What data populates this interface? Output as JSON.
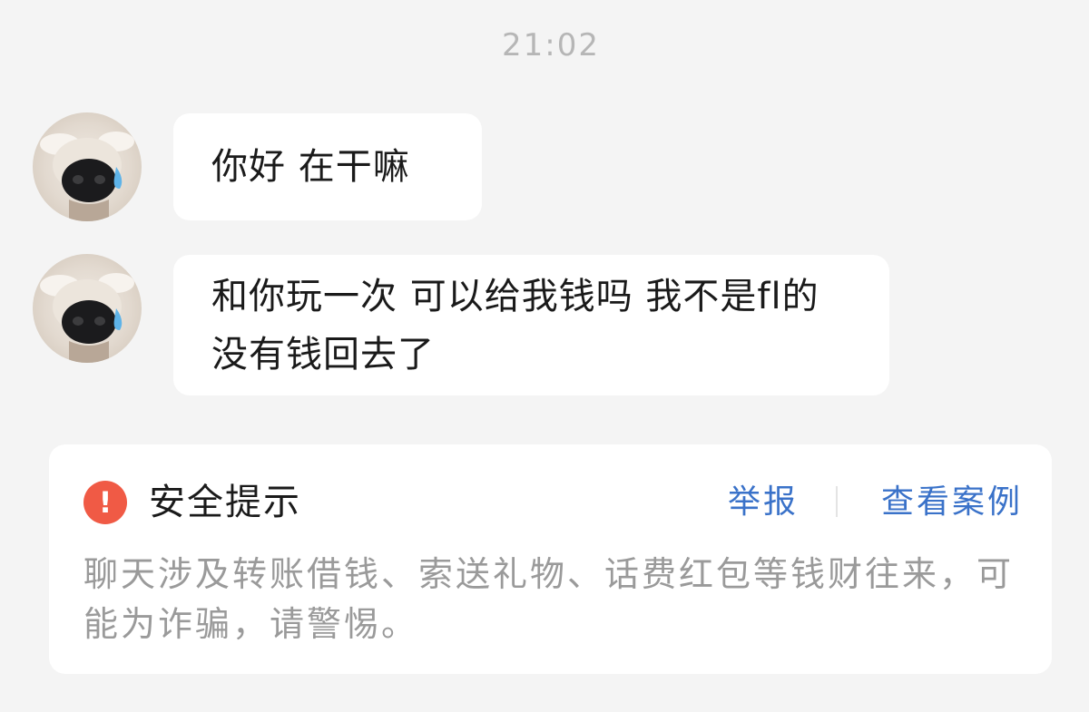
{
  "time": "21:02",
  "messages": [
    {
      "sender": "dog-avatar",
      "text": "你好 在干嘛"
    },
    {
      "sender": "dog-avatar",
      "text": "和你玩一次 可以给我钱吗 我不是fl的 没有钱回去了"
    }
  ],
  "safety": {
    "icon": "!",
    "title": "安全提示",
    "report_label": "举报",
    "cases_label": "查看案例",
    "text": "聊天涉及转账借钱、索送礼物、话费红包等钱财往来，可能为诈骗，请警惕。"
  },
  "colors": {
    "background": "#f4f4f4",
    "bubble": "#ffffff",
    "link": "#3a72c9",
    "warning": "#f05a45",
    "muted_text": "#9a9a9a"
  }
}
